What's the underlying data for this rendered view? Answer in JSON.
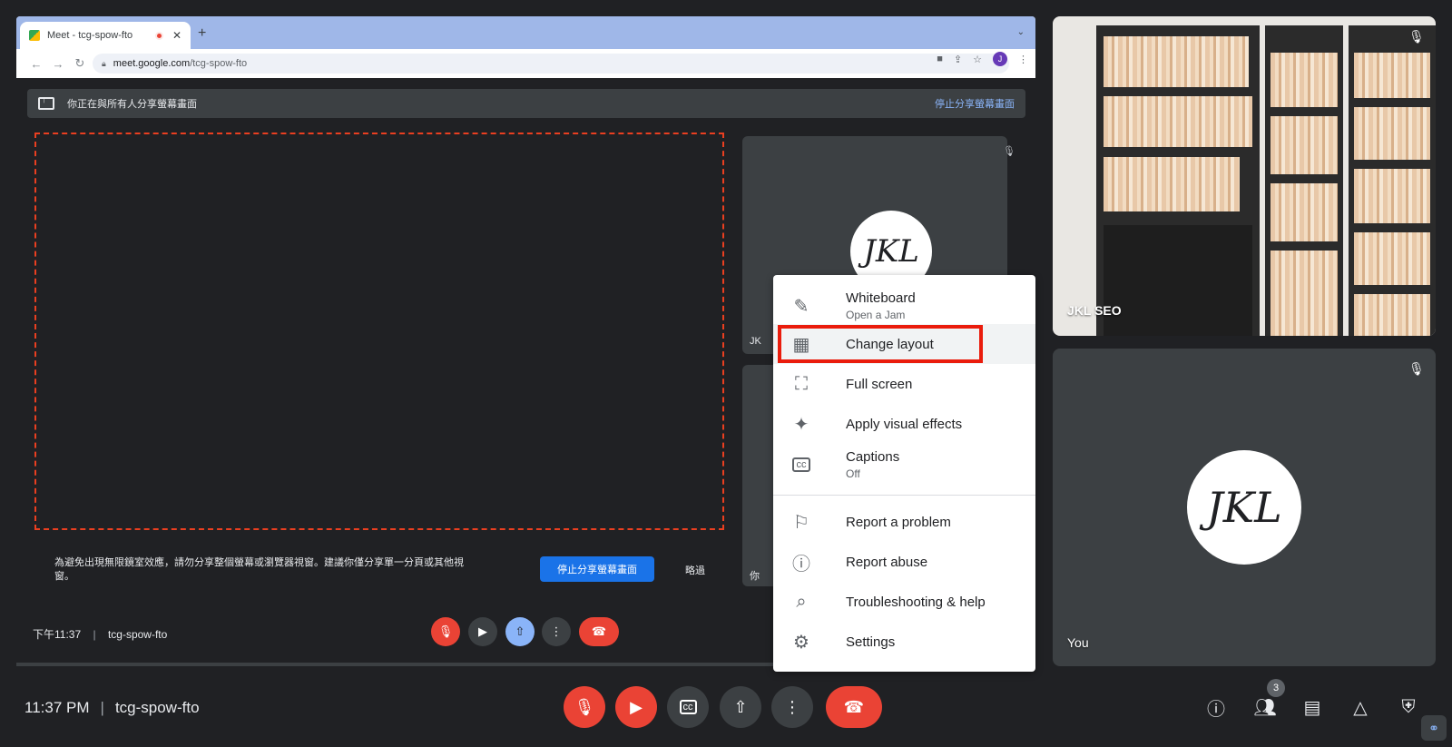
{
  "browser": {
    "tab_title": "Meet - tcg-spow-fto",
    "tab_close": "✕",
    "new_tab": "+",
    "url_host": "meet.google.com",
    "url_path": "/tcg-spow-fto",
    "profile_initial": "J"
  },
  "share_bar": {
    "message": "你正在與所有人分享螢幕畫面",
    "stop_label": "停止分享螢幕畫面"
  },
  "inner_meet": {
    "warning": "為避免出現無限鏡室效應，請勿分享整個螢幕或瀏覽器視窗。建議你僅分享單一分頁或其他視窗。",
    "stop_button": "停止分享螢幕畫面",
    "skip": "略過",
    "time": "下午11:37",
    "meeting_code": "tcg-spow-fto",
    "tile1_label": "JK",
    "tile2_label": "你",
    "avatar_text": "JKL"
  },
  "participants": {
    "remote_name": "JKL SEO",
    "self_name": "You",
    "self_avatar": "JKL"
  },
  "menu": {
    "items": [
      {
        "label": "Whiteboard",
        "sub": "Open a Jam",
        "icon": "pen-icon"
      },
      {
        "label": "Change layout",
        "sub": "",
        "icon": "layout-icon"
      },
      {
        "label": "Full screen",
        "sub": "",
        "icon": "fullscreen-icon"
      },
      {
        "label": "Apply visual effects",
        "sub": "",
        "icon": "sparkle-icon"
      },
      {
        "label": "Captions",
        "sub": "Off",
        "icon": "captions-icon"
      },
      {
        "label": "Report a problem",
        "sub": "",
        "icon": "report-problem-icon"
      },
      {
        "label": "Report abuse",
        "sub": "",
        "icon": "report-abuse-icon"
      },
      {
        "label": "Troubleshooting & help",
        "sub": "",
        "icon": "troubleshoot-icon"
      },
      {
        "label": "Settings",
        "sub": "",
        "icon": "gear-icon"
      }
    ]
  },
  "bottom": {
    "time": "11:37 PM",
    "separator": "|",
    "meeting_code": "tcg-spow-fto",
    "people_count": "3"
  },
  "colors": {
    "background": "#202124",
    "danger": "#ea4335",
    "accent": "#1a73e8",
    "highlight_box": "#ea1c0c"
  }
}
